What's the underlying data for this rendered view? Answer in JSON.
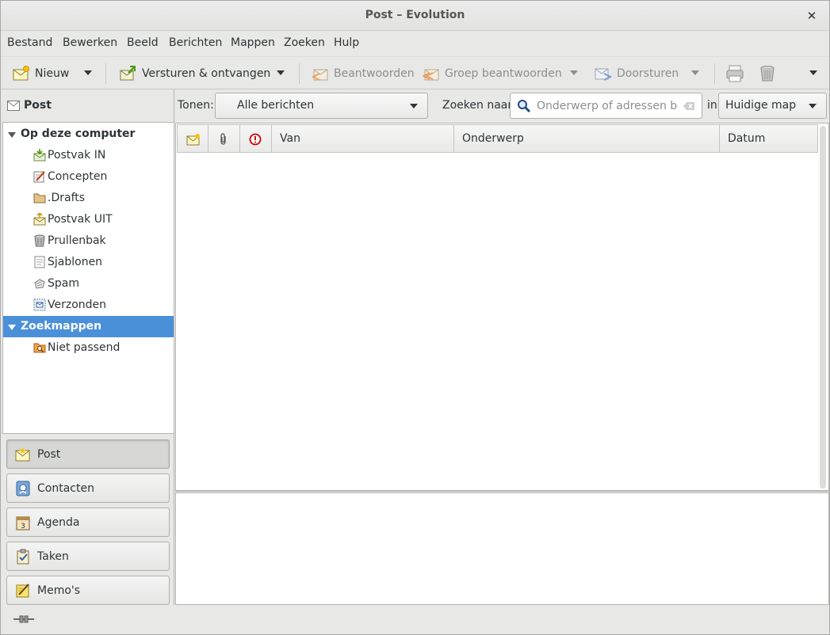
{
  "window": {
    "title": "Post – Evolution"
  },
  "menu": [
    "Bestand",
    "Bewerken",
    "Beeld",
    "Berichten",
    "Mappen",
    "Zoeken",
    "Hulp"
  ],
  "toolbar": {
    "new": "Nieuw",
    "send_receive": "Versturen & ontvangen",
    "reply": "Beantwoorden",
    "reply_group": "Groep beantwoorden",
    "forward": "Doorsturen"
  },
  "sidebar": {
    "header": "Post",
    "account": "Op deze computer",
    "folders": [
      "Postvak IN",
      "Concepten",
      ".Drafts",
      "Postvak UIT",
      "Prullenbak",
      "Sjablonen",
      "Spam",
      "Verzonden"
    ],
    "search_folders": "Zoekmappen",
    "search_folder_items": [
      "Niet passend"
    ]
  },
  "switcher": [
    "Post",
    "Contacten",
    "Agenda",
    "Taken",
    "Memo's"
  ],
  "filter": {
    "show_label": "Tonen:",
    "show_value": "Alle berichten",
    "search_label": "Zoeken naar:",
    "search_placeholder": "Onderwerp of adressen b...",
    "in_label": "in",
    "scope_value": "Huidige map"
  },
  "columns": [
    "Van",
    "Onderwerp",
    "Datum"
  ],
  "colors": {
    "selection": "#4a90d9",
    "background": "#e8e8e7"
  }
}
